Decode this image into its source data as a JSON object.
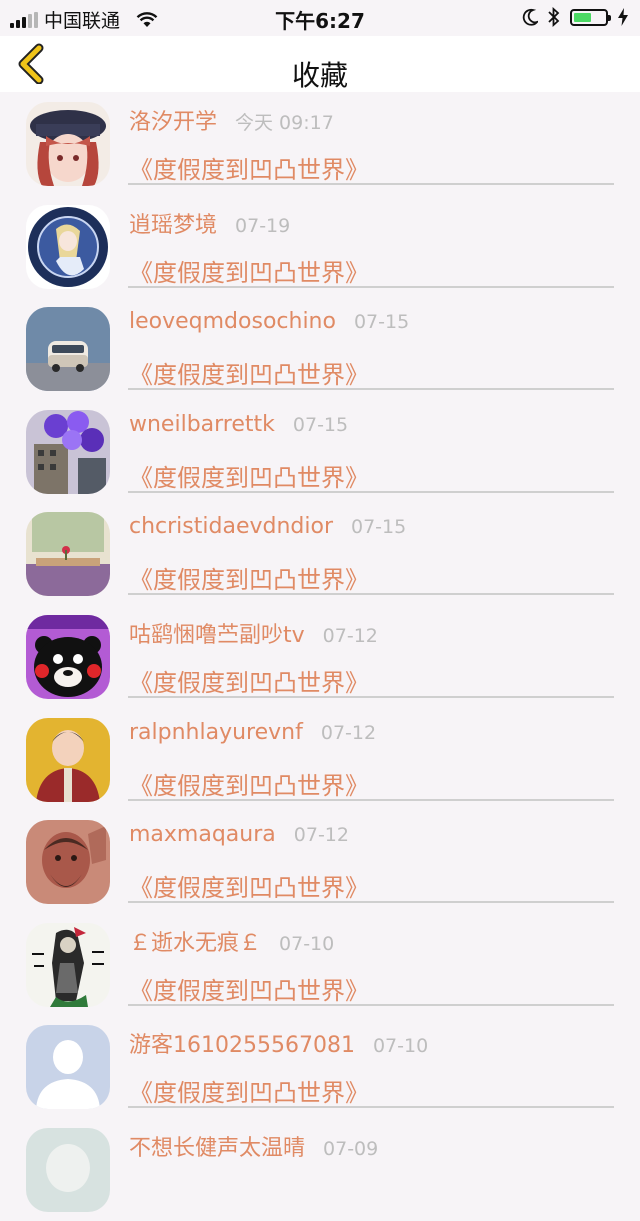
{
  "status_bar": {
    "carrier": "中国联通",
    "time": "下午6:27",
    "icons": [
      "signal-icon",
      "wifi-icon",
      "moon-icon",
      "bluetooth-icon",
      "battery-icon",
      "charging-icon"
    ],
    "battery_level": 0.55
  },
  "nav": {
    "title": "收藏",
    "back_icon": "chevron-left-icon",
    "accent": "#f0c419"
  },
  "colors": {
    "name": "#e08a64",
    "date": "#bdbdbd"
  },
  "items": [
    {
      "name": "洛汐开学",
      "date": "今天 09:17",
      "title": "《度假度到凹凸世界》"
    },
    {
      "name": "逍瑶梦境",
      "date": "07-19",
      "title": "《度假度到凹凸世界》"
    },
    {
      "name": "leoveqmdosochino",
      "date": "07-15",
      "title": "《度假度到凹凸世界》"
    },
    {
      "name": "wneilbarrettk",
      "date": "07-15",
      "title": "《度假度到凹凸世界》"
    },
    {
      "name": "chcristidaevdndior",
      "date": "07-15",
      "title": "《度假度到凹凸世界》"
    },
    {
      "name": "咕鹞悃噜苎副吵tv",
      "date": "07-12",
      "title": "《度假度到凹凸世界》"
    },
    {
      "name": "ralpnhlayurevnf",
      "date": "07-12",
      "title": "《度假度到凹凸世界》"
    },
    {
      "name": "maxmaqaura",
      "date": "07-12",
      "title": "《度假度到凹凸世界》"
    },
    {
      "name": "￡逝水无痕￡",
      "date": "07-10",
      "title": "《度假度到凹凸世界》"
    },
    {
      "name": "游客1610255567081",
      "date": "07-10",
      "title": "《度假度到凹凸世界》"
    },
    {
      "name": "不想长健声太温晴",
      "date": "07-09",
      "title": ""
    }
  ]
}
